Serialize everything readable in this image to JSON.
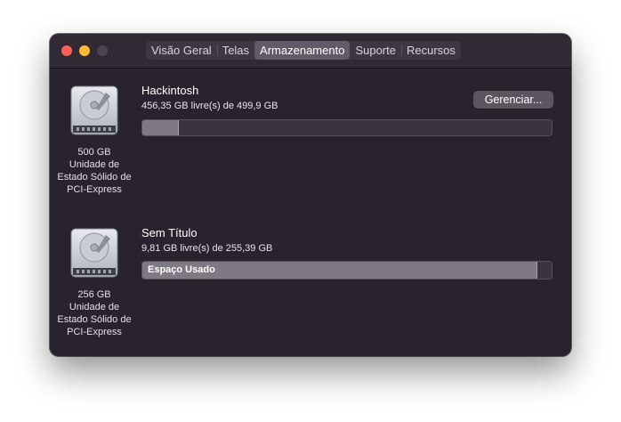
{
  "window": {
    "tabs": [
      {
        "label": "Visão Geral",
        "active": false
      },
      {
        "label": "Telas",
        "active": false
      },
      {
        "label": "Armazenamento",
        "active": true
      },
      {
        "label": "Suporte",
        "active": false
      },
      {
        "label": "Recursos",
        "active": false
      }
    ]
  },
  "disks": [
    {
      "icon": "internal-drive-icon",
      "caption": [
        "500 GB",
        "Unidade de",
        "Estado Sólido de",
        "PCI-Express"
      ],
      "name": "Hackintosh",
      "free_text": "456,35 GB livre(s) de 499,9 GB",
      "used_fraction": 0.087,
      "bar_label": "",
      "manage_label": "Gerenciar..."
    },
    {
      "icon": "internal-drive-icon",
      "caption": [
        "256 GB",
        "Unidade de",
        "Estado Sólido de",
        "PCI-Express"
      ],
      "name": "Sem Título",
      "free_text": "9,81 GB livre(s) de 255,39 GB",
      "used_fraction": 0.962,
      "bar_label": "Espaço Usado"
    }
  ],
  "colors": {
    "window_bg": "#29232d",
    "bar_fill": "#7f7986",
    "close": "#fe5f57",
    "minimize": "#febc2e"
  }
}
